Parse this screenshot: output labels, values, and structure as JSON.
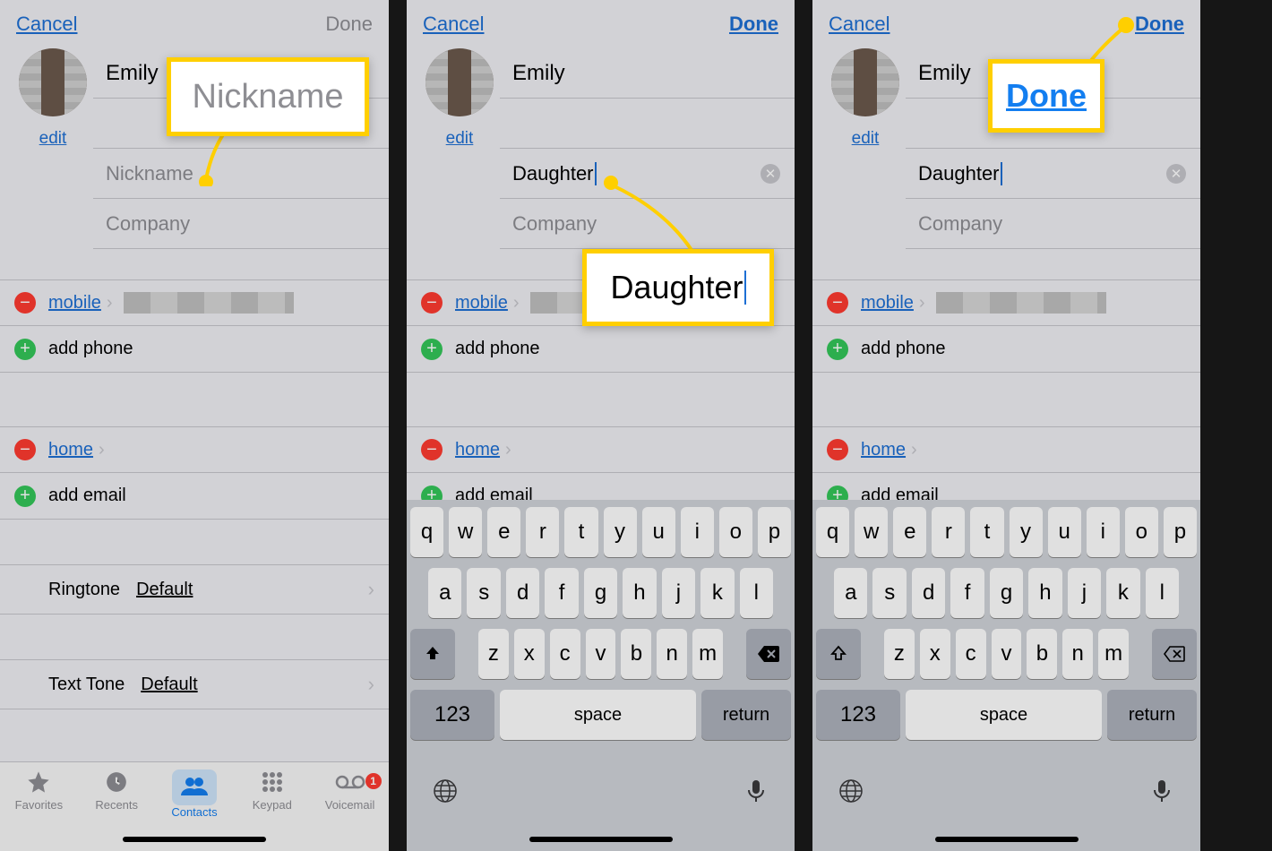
{
  "header": {
    "cancel": "Cancel",
    "done": "Done"
  },
  "contact": {
    "first_name": "Emily",
    "edit_label": "edit",
    "nickname_placeholder": "Nickname",
    "nickname_value": "Daughter",
    "company_placeholder": "Company"
  },
  "phone": {
    "mobile_label": "mobile",
    "add_phone": "add phone"
  },
  "email": {
    "home_label": "home",
    "add_email": "add email"
  },
  "ringtone": {
    "label": "Ringtone",
    "value": "Default"
  },
  "texttone": {
    "label": "Text Tone",
    "value": "Default"
  },
  "tabs": {
    "favorites": "Favorites",
    "recents": "Recents",
    "contacts": "Contacts",
    "keypad": "Keypad",
    "voicemail": "Voicemail",
    "voicemail_badge": "1"
  },
  "keyboard": {
    "row1": [
      "q",
      "w",
      "e",
      "r",
      "t",
      "y",
      "u",
      "i",
      "o",
      "p"
    ],
    "row2": [
      "a",
      "s",
      "d",
      "f",
      "g",
      "h",
      "j",
      "k",
      "l"
    ],
    "row3": [
      "z",
      "x",
      "c",
      "v",
      "b",
      "n",
      "m"
    ],
    "k123": "123",
    "space": "space",
    "return": "return"
  },
  "callouts": {
    "s1": "Nickname",
    "s2": "Daughter",
    "s3": "Done"
  }
}
